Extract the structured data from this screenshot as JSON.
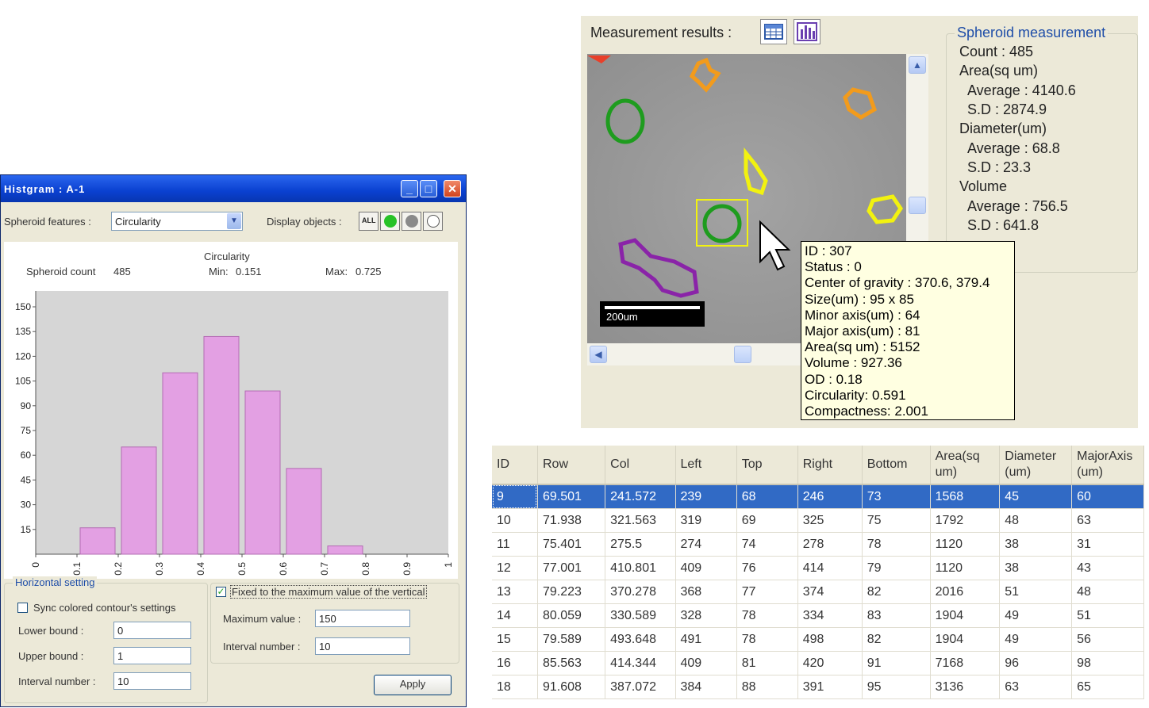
{
  "histogram_window": {
    "title": "Histgram : A-1",
    "spheroid_features_label": "Spheroid features :",
    "spheroid_features_value": "Circularity",
    "display_objects_label": "Display objects :",
    "display_all_label": "ALL",
    "display_colors": [
      "#27c227",
      "#8a8a8a",
      "#ffffff"
    ],
    "stats": {
      "spheroid_count_label": "Spheroid count",
      "spheroid_count": "485",
      "feature_title": "Circularity",
      "min_label": "Min:",
      "min": "0.151",
      "max_label": "Max:",
      "max": "0.725"
    },
    "horizontal_setting": {
      "title": "Horizontal setting",
      "sync_label": "Sync colored contour's settings",
      "sync_checked": false,
      "lower_bound_label": "Lower bound :",
      "lower_bound": "0",
      "upper_bound_label": "Upper bound :",
      "upper_bound": "1",
      "interval_label": "Interval number :",
      "interval": "10"
    },
    "vertical_setting": {
      "fixed_label": "Fixed to the maximum value of the vertical",
      "fixed_checked": true,
      "max_value_label": "Maximum value :",
      "max_value": "150",
      "interval_label": "Interval number :",
      "interval": "10"
    },
    "apply_label": "Apply",
    "colors": {
      "bar_fill": "#e3a0e3",
      "bar_stroke": "#b36bb3",
      "plot_bg": "#d6d6d6",
      "titlebar": "#0a40d0"
    }
  },
  "chart_data": {
    "type": "bar",
    "categories": [
      "0.1-0.2",
      "0.2-0.3",
      "0.3-0.4",
      "0.4-0.5",
      "0.5-0.6",
      "0.6-0.7",
      "0.7-0.8"
    ],
    "bins": [
      [
        0.1,
        0.2
      ],
      [
        0.2,
        0.3
      ],
      [
        0.3,
        0.4
      ],
      [
        0.4,
        0.5
      ],
      [
        0.5,
        0.6
      ],
      [
        0.6,
        0.7
      ],
      [
        0.7,
        0.8
      ]
    ],
    "values": [
      16,
      65,
      110,
      132,
      99,
      52,
      5
    ],
    "x_ticks": [
      "0",
      "0.1",
      "0.2",
      "0.3",
      "0.4",
      "0.5",
      "0.6",
      "0.7",
      "0.8",
      "0.9",
      "1"
    ],
    "y_ticks": [
      "15",
      "30",
      "45",
      "60",
      "75",
      "90",
      "105",
      "120",
      "135",
      "150"
    ],
    "xlim": [
      0,
      1
    ],
    "ylim": [
      0,
      150
    ]
  },
  "measurement": {
    "label": "Measurement results :",
    "scale_bar_label": "200um",
    "spheroid_measurement": {
      "title": "Spheroid measurement",
      "lines": [
        "Count : 485",
        "Area(sq um)",
        "Average : 4140.6",
        "S.D : 2874.9",
        "Diameter(um)",
        "Average : 68.8",
        "S.D : 23.3",
        "Volume",
        "Average : 756.5",
        "S.D : 641.8"
      ]
    },
    "tooltip": [
      "ID : 307",
      "Status : 0",
      "Center of gravity : 370.6, 379.4",
      "Size(um) : 95 x 85",
      "Minor axis(um) : 64",
      "Major axis(um) : 81",
      "Area(sq um) : 5152",
      "Volume : 927.36",
      "OD : 0.18",
      "Circularity: 0.591",
      "Compactness: 2.001"
    ]
  },
  "table": {
    "headers": [
      "ID",
      "Row",
      "Col",
      "Left",
      "Top",
      "Right",
      "Bottom",
      "Area(sq um)",
      "Diameter (um)",
      "MajorAxis (um)"
    ],
    "rows": [
      [
        "9",
        "69.501",
        "241.572",
        "239",
        "68",
        "246",
        "73",
        "1568",
        "45",
        "60"
      ],
      [
        "10",
        "71.938",
        "321.563",
        "319",
        "69",
        "325",
        "75",
        "1792",
        "48",
        "63"
      ],
      [
        "11",
        "75.401",
        "275.5",
        "274",
        "74",
        "278",
        "78",
        "1120",
        "38",
        "31"
      ],
      [
        "12",
        "77.001",
        "410.801",
        "409",
        "76",
        "414",
        "79",
        "1120",
        "38",
        "43"
      ],
      [
        "13",
        "79.223",
        "370.278",
        "368",
        "77",
        "374",
        "82",
        "2016",
        "51",
        "48"
      ],
      [
        "14",
        "80.059",
        "330.589",
        "328",
        "78",
        "334",
        "83",
        "1904",
        "49",
        "51"
      ],
      [
        "15",
        "79.589",
        "493.648",
        "491",
        "78",
        "498",
        "82",
        "1904",
        "49",
        "56"
      ],
      [
        "16",
        "85.563",
        "414.344",
        "409",
        "81",
        "420",
        "91",
        "7168",
        "96",
        "98"
      ],
      [
        "18",
        "91.608",
        "387.072",
        "384",
        "88",
        "391",
        "95",
        "3136",
        "63",
        "65"
      ]
    ],
    "selected_row": 0
  }
}
